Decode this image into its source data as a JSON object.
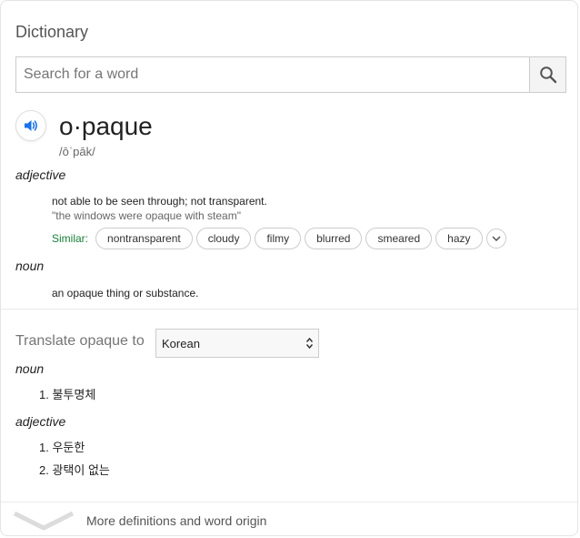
{
  "dictionary": {
    "title": "Dictionary",
    "search": {
      "placeholder": "Search for a word"
    },
    "entry": {
      "word": "o·paque",
      "phonetic": "/ōˈpāk/",
      "senses": [
        {
          "pos": "adjective",
          "definition": "not able to be seen through; not transparent.",
          "example": "\"the windows were opaque with steam\"",
          "similar_label": "Similar:",
          "similar": [
            "nontransparent",
            "cloudy",
            "filmy",
            "blurred",
            "smeared",
            "hazy"
          ]
        },
        {
          "pos": "noun",
          "definition": "an opaque thing or substance."
        }
      ]
    },
    "translate": {
      "label": "Translate opaque to",
      "language": "Korean",
      "groups": [
        {
          "pos": "noun",
          "items": [
            "1. 불투명체"
          ]
        },
        {
          "pos": "adjective",
          "items": [
            "1. 우둔한",
            "2. 광택이 없는"
          ]
        }
      ]
    },
    "footer": {
      "link": "More definitions and word origin"
    }
  }
}
